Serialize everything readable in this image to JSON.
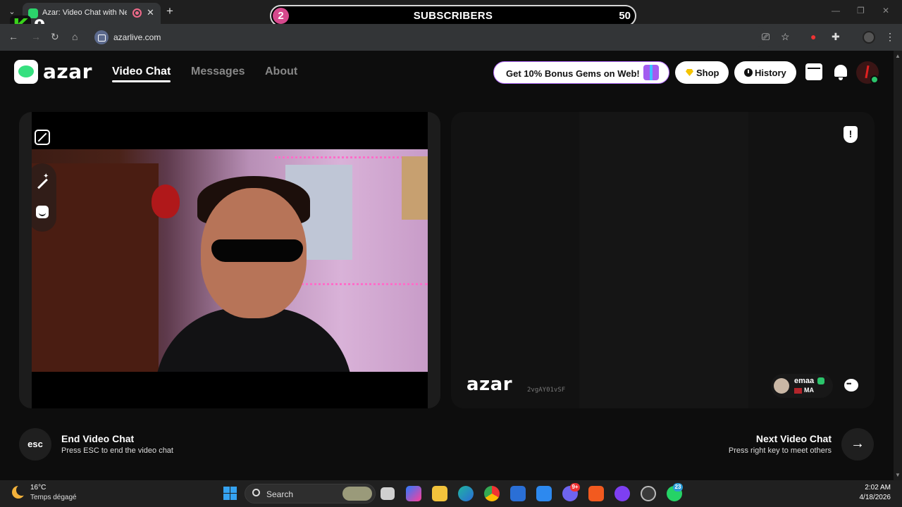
{
  "browser": {
    "tab_title": "Azar: Video Chat with New",
    "url": "azarlive.com"
  },
  "overlay": {
    "logo_letter": "K",
    "logo_number": "9",
    "subscriber_count": "2",
    "subscriber_label": "SUBSCRIBERS",
    "subscriber_goal": "50"
  },
  "header": {
    "logo": "azar",
    "nav": [
      "Video Chat",
      "Messages",
      "About"
    ],
    "promo": "Get 10% Bonus Gems on Web!",
    "shop_label": "Shop",
    "history_label": "History"
  },
  "remote": {
    "logo": "azar",
    "session_id": "2vgAY01vSF",
    "peer_name": "emaa",
    "peer_country": "MA"
  },
  "controls": {
    "end_key": "esc",
    "end_title": "End Video Chat",
    "end_hint": "Press ESC to end the video chat",
    "next_title": "Next Video Chat",
    "next_hint": "Press right key to meet others",
    "next_arrow": "→"
  },
  "taskbar": {
    "temperature": "16°C",
    "weather": "Temps dégagé",
    "search_placeholder": "Search",
    "discord_badge": "9+",
    "whatsapp_badge": "23",
    "time": "2:02 AM",
    "date": "4/18/2026"
  },
  "colors": {
    "accent_green": "#36e07f",
    "subscriber_pink": "#d6498d",
    "promo_purple": "#b46bff"
  }
}
